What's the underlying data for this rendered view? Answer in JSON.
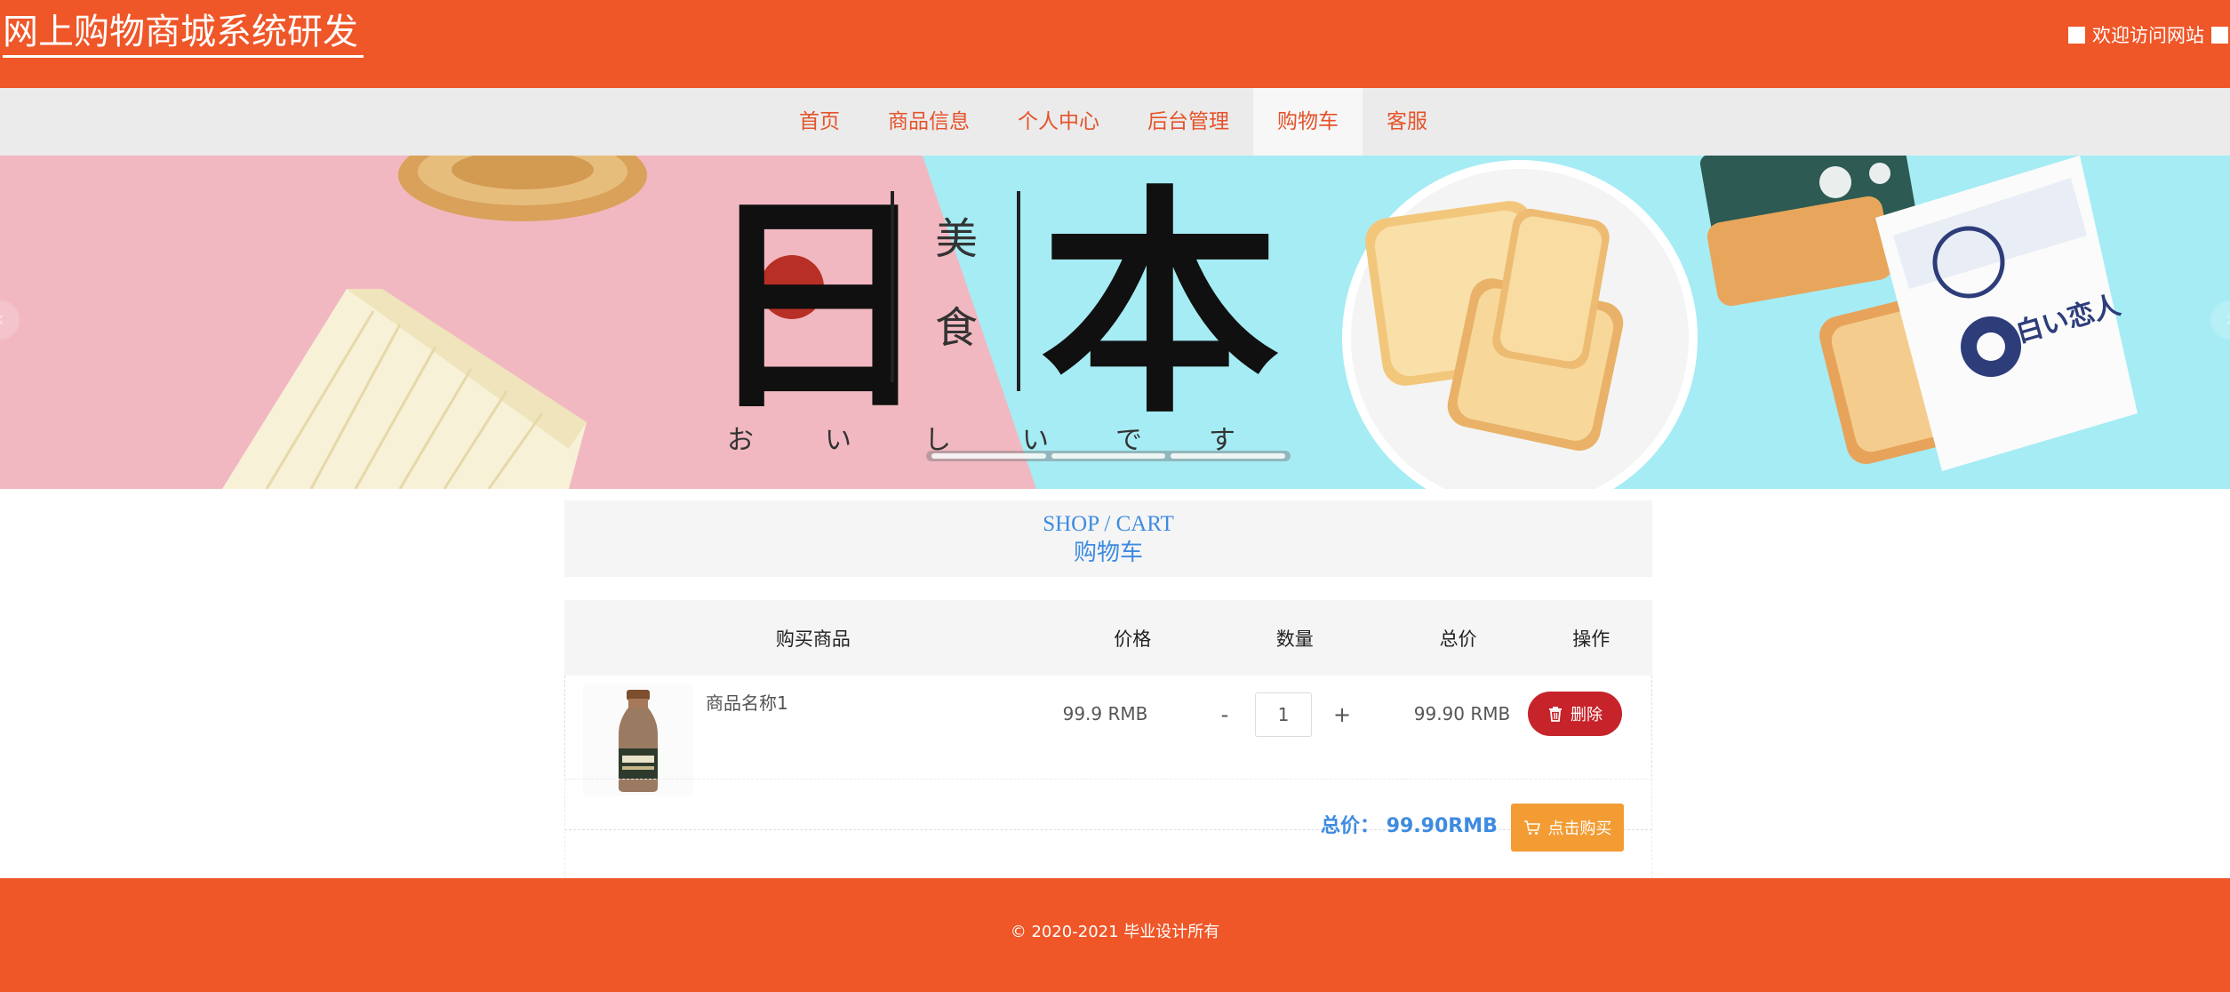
{
  "header": {
    "site_title": "网上购物商城系统研发",
    "welcome_text": "欢迎访问网站"
  },
  "nav": {
    "items": [
      {
        "label": "首页"
      },
      {
        "label": "商品信息"
      },
      {
        "label": "个人中心"
      },
      {
        "label": "后台管理"
      },
      {
        "label": "购物车",
        "active": true
      },
      {
        "label": "客服"
      }
    ]
  },
  "banner": {
    "big_char_1": "日",
    "big_char_2": "本",
    "small_char_1": "美",
    "small_char_2": "食",
    "kana": [
      "お",
      "い",
      "し",
      "い",
      "で",
      "す"
    ],
    "package_text": "白い恋人",
    "slide_count": 3,
    "active_slide": 2
  },
  "cart_section": {
    "title_en": "SHOP / CART",
    "title_cn": "购物车"
  },
  "cart_table": {
    "headers": {
      "product": "购买商品",
      "price": "价格",
      "quantity": "数量",
      "total": "总价",
      "operation": "操作"
    },
    "rows": [
      {
        "name": "商品名称1",
        "price": "99.9 RMB",
        "quantity": "1",
        "minus": "-",
        "plus": "+",
        "total": "99.90 RMB",
        "delete_label": "删除"
      }
    ]
  },
  "summary": {
    "total_label": "总价：",
    "total_value": "99.90RMB",
    "buy_label": "点击购买"
  },
  "footer": {
    "copyright": "© 2020-2021 毕业设计所有"
  },
  "colors": {
    "brand_orange": "#ef5628",
    "nav_text": "#e5532a",
    "accent_blue": "#3e8be0",
    "delete_red": "#c6232a",
    "buy_orange": "#f39c34",
    "banner_pink": "#f2b8c1",
    "banner_cyan": "#a6ecf4"
  }
}
